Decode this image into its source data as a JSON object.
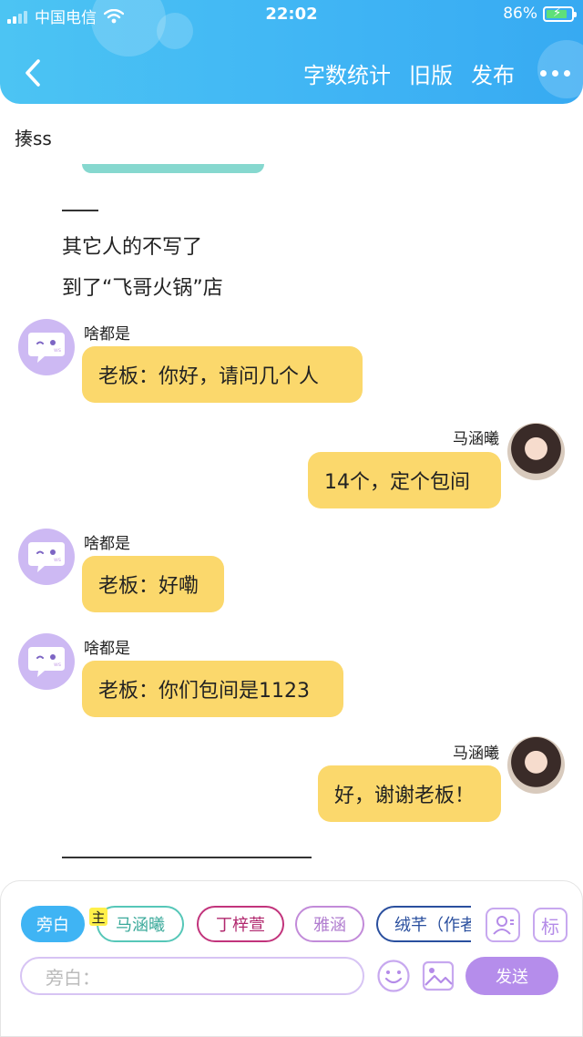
{
  "status_bar": {
    "carrier": "中国电信",
    "time": "22:02",
    "battery": "86%",
    "battery_level": 0.86
  },
  "nav": {
    "back_icon": "chevron-left-icon",
    "actions": [
      "字数统计",
      "旧版",
      "发布"
    ],
    "more_icon": "more-icon"
  },
  "document": {
    "title": "揍ss",
    "narration": [
      "其它人的不写了",
      "到了“飞哥火锅”店"
    ]
  },
  "messages": [
    {
      "side": "left",
      "name": "啥都是",
      "text": "老板：你好，请问几个人"
    },
    {
      "side": "right",
      "name": "马涵曦",
      "text": "14个，定个包间"
    },
    {
      "side": "left",
      "name": "啥都是",
      "text": "老板：好嘞"
    },
    {
      "side": "left",
      "name": "啥都是",
      "text": "老板：你们包间是1123"
    },
    {
      "side": "right",
      "name": "马涵曦",
      "text": "好，谢谢老板！"
    }
  ],
  "composer": {
    "main_badge": "主",
    "chips": [
      {
        "label": "旁白",
        "color": "#3fb4f4",
        "active": true
      },
      {
        "label": "马涵曦",
        "color": "#56c7b8",
        "active": false
      },
      {
        "label": "丁梓萱",
        "color": "#c2347c",
        "active": false
      },
      {
        "label": "雅涵",
        "color": "#c28bd9",
        "active": false
      },
      {
        "label": "绒芊（作者）",
        "color": "#2a4f9e",
        "active": false
      }
    ],
    "character_icon": "person-card-icon",
    "mark_label": "标",
    "input_placeholder": "旁白：",
    "emoji_icon": "emoji-icon",
    "image_icon": "image-icon",
    "send_label": "发送"
  },
  "colors": {
    "header": "#3fb4f4",
    "bubble": "#fbd86c",
    "avatar_bot": "#cdb9f3",
    "accent_purple": "#b58deb"
  }
}
